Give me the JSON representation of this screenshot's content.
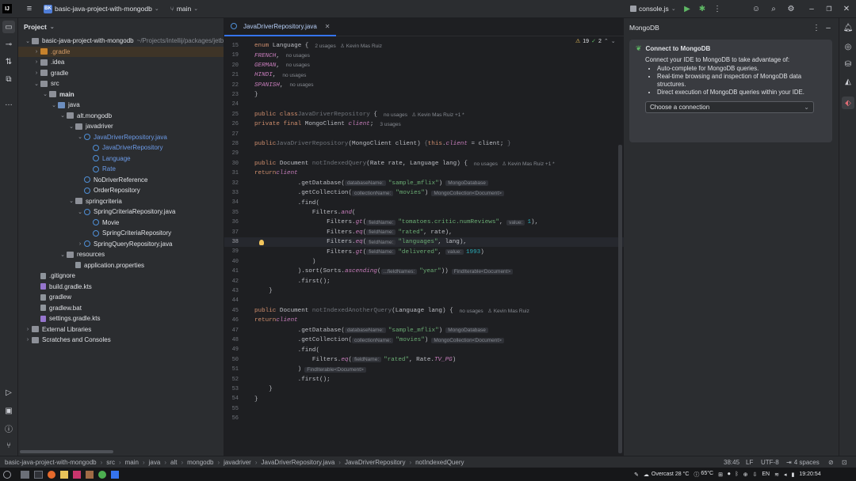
{
  "titlebar": {
    "project_badge": "BK",
    "project_name": "basic-java-project-with-mongodb",
    "branch": "main",
    "run_config": "console.js"
  },
  "project_panel": {
    "title": "Project",
    "tree": [
      {
        "label": "basic-java-project-with-mongodb",
        "suffix": "~/Projects/intellij/packages/jetb",
        "depth": 0,
        "arrow": "open",
        "icon": "folder"
      },
      {
        "label": ".gradle",
        "depth": 1,
        "arrow": "closed",
        "icon": "gfolder",
        "orange": true
      },
      {
        "label": ".idea",
        "depth": 1,
        "arrow": "closed",
        "icon": "folder"
      },
      {
        "label": "gradle",
        "depth": 1,
        "arrow": "closed",
        "icon": "folder"
      },
      {
        "label": "src",
        "depth": 1,
        "arrow": "open",
        "icon": "folder"
      },
      {
        "label": "main",
        "depth": 2,
        "arrow": "open",
        "icon": "folder",
        "bold": true
      },
      {
        "label": "java",
        "depth": 3,
        "arrow": "open",
        "icon": "bfolder"
      },
      {
        "label": "alt.mongodb",
        "depth": 4,
        "arrow": "open",
        "icon": "folder"
      },
      {
        "label": "javadriver",
        "depth": 5,
        "arrow": "open",
        "icon": "folder"
      },
      {
        "label": "JavaDriverRepository.java",
        "depth": 6,
        "arrow": "open",
        "icon": "java",
        "blue": true
      },
      {
        "label": "JavaDriverRepository",
        "depth": 7,
        "arrow": "",
        "icon": "java",
        "blue": true
      },
      {
        "label": "Language",
        "depth": 7,
        "arrow": "",
        "icon": "java",
        "blue": true
      },
      {
        "label": "Rate",
        "depth": 7,
        "arrow": "",
        "icon": "java",
        "blue": true
      },
      {
        "label": "NoDriverReference",
        "depth": 6,
        "arrow": "",
        "icon": "java"
      },
      {
        "label": "OrderRepository",
        "depth": 6,
        "arrow": "",
        "icon": "java"
      },
      {
        "label": "springcriteria",
        "depth": 5,
        "arrow": "open",
        "icon": "folder"
      },
      {
        "label": "SpringCriteriaRepository.java",
        "depth": 6,
        "arrow": "open",
        "icon": "java"
      },
      {
        "label": "Movie",
        "depth": 7,
        "arrow": "",
        "icon": "java"
      },
      {
        "label": "SpringCriteriaRepository",
        "depth": 7,
        "arrow": "",
        "icon": "java"
      },
      {
        "label": "SpringQueryRepository.java",
        "depth": 6,
        "arrow": "closed",
        "icon": "java"
      },
      {
        "label": "resources",
        "depth": 4,
        "arrow": "open",
        "icon": "folder"
      },
      {
        "label": "application.properties",
        "depth": 5,
        "arrow": "",
        "icon": "file"
      },
      {
        "label": ".gitignore",
        "depth": 1,
        "arrow": "",
        "icon": "file"
      },
      {
        "label": "build.gradle.kts",
        "depth": 1,
        "arrow": "",
        "icon": "kt"
      },
      {
        "label": "gradlew",
        "depth": 1,
        "arrow": "",
        "icon": "file"
      },
      {
        "label": "gradlew.bat",
        "depth": 1,
        "arrow": "",
        "icon": "file"
      },
      {
        "label": "settings.gradle.kts",
        "depth": 1,
        "arrow": "",
        "icon": "kt"
      },
      {
        "label": "External Libraries",
        "depth": 0,
        "arrow": "closed",
        "icon": "lib"
      },
      {
        "label": "Scratches and Consoles",
        "depth": 0,
        "arrow": "closed",
        "icon": "lib"
      }
    ]
  },
  "editor": {
    "tab_label": "JavaDriverRepository.java",
    "problems": {
      "warnings": "19",
      "checks": "2"
    },
    "lines": [
      {
        "n": "15",
        "html": "<span class='kw'>enum</span> Language {<span class='ann'>2 usages &nbsp;&nbsp;♙ Kevin Mas Ruiz</span>"
      },
      {
        "n": "19",
        "html": "    <span class='it'>FRENCH</span>,<span class='ann'>no usages</span>"
      },
      {
        "n": "20",
        "html": "    <span class='it'>GERMAN</span>,<span class='ann'>no usages</span>"
      },
      {
        "n": "21",
        "html": "    <span class='it'>HINDI</span>,<span class='ann'>no usages</span>"
      },
      {
        "n": "22",
        "html": "    <span class='it'>SPANISH</span>,<span class='ann'>no usages</span>"
      },
      {
        "n": "23",
        "html": "}"
      },
      {
        "n": "24",
        "html": ""
      },
      {
        "n": "25",
        "html": "<span class='kw'>public class</span> <span class='dim'>JavaDriverRepository</span> {<span class='ann'>no usages &nbsp;&nbsp;♙ Kevin Mas Ruiz +1 *</span>"
      },
      {
        "n": "26",
        "html": "    <span class='kw'>private final</span> MongoClient <span class='it'>client</span>;<span class='ann'>3 usages</span>"
      },
      {
        "n": "27",
        "html": ""
      },
      {
        "n": "28",
        "html": "    <span class='kw'>public</span> <span class='dim'>JavaDriverRepository</span>(MongoClient client) <span class='dim'>{</span> <span class='kw'>this</span>.<span class='it'>client</span> = client; <span class='dim'>}</span>"
      },
      {
        "n": "29",
        "html": ""
      },
      {
        "n": "30",
        "html": "    <span class='kw'>public</span> Document <span class='dim'>notIndexedQuery</span>(Rate rate, Language lang) {<span class='ann'>no usages &nbsp;&nbsp;♙ Kevin Mas Ruiz +1 *</span>"
      },
      {
        "n": "31",
        "html": "        <span class='kw'>return</span> <span class='it'>client</span>"
      },
      {
        "n": "32",
        "html": "            .getDatabase(<span class='hint'>databaseName:</span><span class='str'>\"sample_mflix\"</span>)<span class='typehint'>MongoDatabase</span>"
      },
      {
        "n": "33",
        "html": "            .getCollection(<span class='hint'>collectionName:</span><span class='str'>\"movies\"</span>)<span class='typehint'>MongoCollection&lt;Document&gt;</span>"
      },
      {
        "n": "34",
        "html": "            .find("
      },
      {
        "n": "35",
        "html": "                Filters.<span class='it'>and</span>("
      },
      {
        "n": "36",
        "html": "                    Filters.<span class='it'>gt</span>(<span class='hint'>fieldName:</span><span class='str'>\"tomatoes.critic.numReviews\"</span>, <span class='hint'>value:</span><span class='num'>1</span>),"
      },
      {
        "n": "37",
        "html": "                    Filters.<span class='it'>eq</span>(<span class='hint'>fieldName:</span><span class='str'>\"rated\"</span>, rate),"
      },
      {
        "n": "38",
        "html": "                    Filters.<span class='it'>eq</span>(<span class='hint'>fieldName:</span><span class='str'>\"languages\"</span>, lang),"
      },
      {
        "n": "39",
        "html": "                    Filters.<span class='it'>gt</span>(<span class='hint'>fieldName:</span><span class='str'>\"delivered\"</span>, <span class='hint'>value:</span><span class='num'>1993</span>)"
      },
      {
        "n": "40",
        "html": "                )"
      },
      {
        "n": "41",
        "html": "            ).sort(Sorts.<span class='it'>ascending</span>(<span class='hint'>...fieldNames:</span><span class='str'>\"year\"</span>))<span class='typehint'>FindIterable&lt;Document&gt;</span>"
      },
      {
        "n": "42",
        "html": "            .first();"
      },
      {
        "n": "43",
        "html": "    }"
      },
      {
        "n": "44",
        "html": ""
      },
      {
        "n": "45",
        "html": "    <span class='kw'>public</span> Document <span class='dim'>notIndexedAnotherQuery</span>(Language lang) {<span class='ann'>no usages &nbsp;&nbsp;♙ Kevin Mas Ruiz</span>"
      },
      {
        "n": "46",
        "html": "        <span class='kw'>return</span> <span class='it'>client</span>"
      },
      {
        "n": "47",
        "html": "            .getDatabase(<span class='hint'>databaseName:</span><span class='str'>\"sample_mflix\"</span>)<span class='typehint'>MongoDatabase</span>"
      },
      {
        "n": "48",
        "html": "            .getCollection(<span class='hint'>collectionName:</span><span class='str'>\"movies\"</span>)<span class='typehint'>MongoCollection&lt;Document&gt;</span>"
      },
      {
        "n": "49",
        "html": "            .find("
      },
      {
        "n": "50",
        "html": "                Filters.<span class='it'>eq</span>(<span class='hint'>fieldName:</span><span class='str'>\"rated\"</span>, Rate.<span class='it'>TV_PG</span>)"
      },
      {
        "n": "51",
        "html": "            )<span class='typehint'>FindIterable&lt;Document&gt;</span>"
      },
      {
        "n": "52",
        "html": "            .first();"
      },
      {
        "n": "53",
        "html": "    }"
      },
      {
        "n": "54",
        "html": "}"
      },
      {
        "n": "55",
        "html": ""
      },
      {
        "n": "56",
        "html": ""
      }
    ]
  },
  "mongodb": {
    "title": "MongoDB",
    "heading": "Connect to MongoDB",
    "intro": "Connect your IDE to MongoDB to take advantage of:",
    "bullets": [
      "Auto-complete for MongoDB queries.",
      "Real-time browsing and inspection of MongoDB data structures.",
      "Direct execution of MongoDB queries within your IDE."
    ],
    "select_placeholder": "Choose a connection"
  },
  "statusbar": {
    "breadcrumbs": [
      "basic-java-project-with-mongodb",
      "src",
      "main",
      "java",
      "alt",
      "mongodb",
      "javadriver",
      "JavaDriverRepository.java",
      "JavaDriverRepository",
      "notIndexedQuery"
    ],
    "position": "38:45",
    "line_sep": "LF",
    "encoding": "UTF-8",
    "indent": "4 spaces"
  },
  "taskbar": {
    "weather": "Overcast 28 °C",
    "cpu_temp": "65°C",
    "lang": "EN",
    "clock": "19:20:54"
  }
}
